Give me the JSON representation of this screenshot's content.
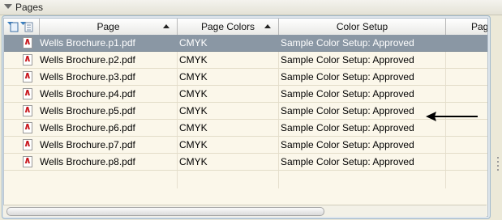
{
  "panel": {
    "title": "Pages"
  },
  "columns": [
    {
      "label": "Page"
    },
    {
      "label": "Page Colors"
    },
    {
      "label": "Color Setup"
    },
    {
      "label": "Pag"
    }
  ],
  "rows": [
    {
      "page": "Wells Brochure.p1.pdf",
      "colors": "CMYK",
      "setup": "Sample Color Setup: Approved",
      "selected": true
    },
    {
      "page": "Wells Brochure.p2.pdf",
      "colors": "CMYK",
      "setup": "Sample Color Setup: Approved"
    },
    {
      "page": "Wells Brochure.p3.pdf",
      "colors": "CMYK",
      "setup": "Sample Color Setup: Approved"
    },
    {
      "page": "Wells Brochure.p4.pdf",
      "colors": "CMYK",
      "setup": "Sample Color Setup: Approved"
    },
    {
      "page": "Wells Brochure.p5.pdf",
      "colors": "CMYK",
      "setup": "Sample Color Setup: Approved"
    },
    {
      "page": "Wells Brochure.p6.pdf",
      "colors": "CMYK",
      "setup": "Sample Color Setup: Approved"
    },
    {
      "page": "Wells Brochure.p7.pdf",
      "colors": "CMYK",
      "setup": "Sample Color Setup: Approved"
    },
    {
      "page": "Wells Brochure.p8.pdf",
      "colors": "CMYK",
      "setup": "Sample Color Setup: Approved"
    }
  ],
  "icons": {
    "panel_toggle": "collapse-triangle-icon",
    "column_chooser": "column-chooser-icon",
    "file": "pdf-file-icon",
    "sort": "sort-ascending-icon",
    "annotation": "left-arrow-annotation"
  },
  "colors": {
    "selection": "#8a97a4",
    "row_background": "#fbf7ea",
    "pdf_red": "#c8141a"
  }
}
